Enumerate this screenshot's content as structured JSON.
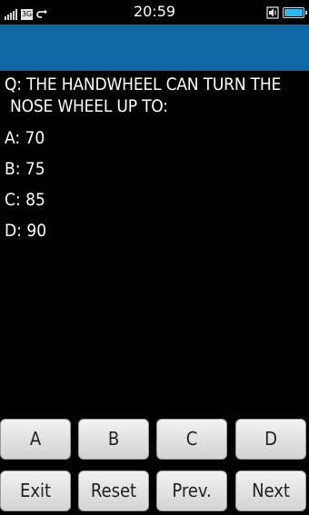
{
  "status_bar": {
    "network_badge": "3G",
    "time": "20:59",
    "battery_level": 1.0,
    "battery_color": "#2fb7ef",
    "icons": [
      "signal-icon",
      "network-3g-icon",
      "sync-icon",
      "volume-icon",
      "battery-icon"
    ]
  },
  "title_bar": {
    "color": "#0f67a6"
  },
  "question": {
    "line1": "Q: THE HANDWHEEL CAN TURN THE",
    "line2": "NOSE WHEEL UP TO:"
  },
  "options": [
    {
      "text": "A: 70"
    },
    {
      "text": "B: 75"
    },
    {
      "text": "C: 85"
    },
    {
      "text": "D: 90"
    }
  ],
  "answer_buttons": [
    {
      "label": "A"
    },
    {
      "label": "B"
    },
    {
      "label": "C"
    },
    {
      "label": "D"
    }
  ],
  "nav_buttons": [
    {
      "label": "Exit"
    },
    {
      "label": "Reset"
    },
    {
      "label": "Prev."
    },
    {
      "label": "Next"
    }
  ]
}
